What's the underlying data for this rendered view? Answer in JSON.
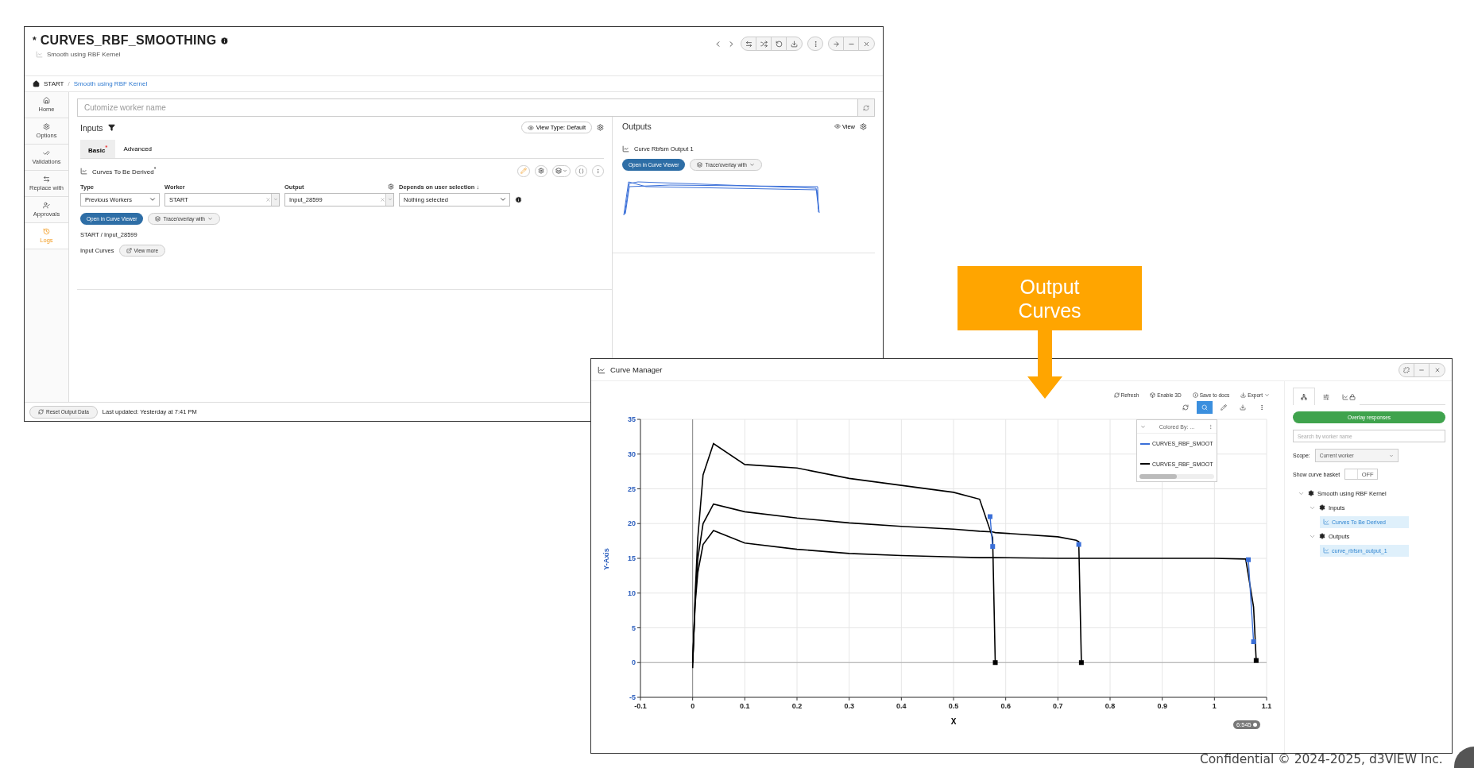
{
  "slide": {
    "callout": "Output Curves",
    "footer": "Confidential © 2024-2025, d3VIEW Inc."
  },
  "worker_window": {
    "modified_mark": "*",
    "title": "CURVES_RBF_SMOOTHING",
    "subtitle": "Smooth using RBF Kernel",
    "breadcrumb": [
      "START",
      "Smooth using RBF Kernel"
    ],
    "breadcrumb_separator": "/",
    "sidebar": [
      {
        "label": "Home",
        "selected": false
      },
      {
        "label": "Options",
        "selected": false
      },
      {
        "label": "Validations",
        "selected": false
      },
      {
        "label": "Replace with",
        "selected": false
      },
      {
        "label": "Approvals",
        "selected": false
      },
      {
        "label": "Logs",
        "selected": true
      }
    ],
    "name_field": {
      "placeholder": "Cutomize worker name"
    },
    "inputs": {
      "title": "Inputs",
      "view_type_button": "View Type: Default",
      "tabs": [
        {
          "label": "Basic",
          "selected": true,
          "mark": "*"
        },
        {
          "label": "Advanced",
          "selected": false
        }
      ],
      "section": {
        "title": "Curves To Be Derived",
        "mark": "*"
      },
      "fields": [
        {
          "label": "Type",
          "value": "Previous Workers",
          "kind": "select"
        },
        {
          "label": "Worker",
          "value": "START",
          "kind": "combo"
        },
        {
          "label": "Output",
          "value": "Input_28599",
          "kind": "combo"
        },
        {
          "label": "Depends on user selection ↓",
          "value": "Nothing selected",
          "kind": "select"
        }
      ],
      "buttons": [
        {
          "label": "Open in Curve Viewer",
          "kind": "primary"
        },
        {
          "label": "Trace/overlay with",
          "kind": "dropdown"
        }
      ],
      "path": "START / Input_28599",
      "curves_label": "Input Curves",
      "view_more_button": "View more"
    },
    "outputs": {
      "title": "Outputs",
      "view_button": "View",
      "curve_title": "Curve Rbfsm Output 1",
      "buttons": [
        {
          "label": "Open in Curve Viewer",
          "kind": "primary"
        },
        {
          "label": "Trace/overlay with",
          "kind": "dropdown"
        }
      ]
    },
    "footer": {
      "reset_button": "Reset Output Data",
      "last_updated": "Last updated: Yesterday at 7:41 PM"
    }
  },
  "curve_manager": {
    "title": "Curve Manager",
    "toolbar": [
      {
        "label": "Refresh",
        "kind": "plain"
      },
      {
        "label": "Enable 3D",
        "kind": "plain"
      },
      {
        "label": "Save to docs",
        "kind": "plain"
      },
      {
        "label": "Export",
        "kind": "dropdown"
      }
    ],
    "tools": [
      {
        "selected": false
      },
      {
        "selected": true
      },
      {
        "selected": false
      },
      {
        "selected": false
      },
      {
        "selected": false
      }
    ],
    "legend": {
      "title": "Colored By: ...",
      "items": [
        {
          "label": "CURVES_RBF_SMOOT",
          "color": "#3a6fd8"
        },
        {
          "label": "CURVES_RBF_SMOOT",
          "color": "#000000"
        }
      ]
    },
    "point_count": "6:545",
    "chart_data": {
      "type": "line",
      "grid": true,
      "xlabel": "X",
      "ylabel": "Y-Axis",
      "xlim": [
        -0.1,
        1.1
      ],
      "ylim": [
        -5,
        35
      ],
      "xticks": [
        -0.1,
        0,
        0.1,
        0.2,
        0.3,
        0.4,
        0.5,
        0.6,
        0.7,
        0.8,
        0.9,
        1,
        1.1
      ],
      "yticks": [
        -5,
        0,
        5,
        10,
        15,
        20,
        25,
        30,
        35
      ],
      "x": [
        0,
        0.005,
        0.01,
        0.02,
        0.04,
        0.1,
        0.2,
        0.3,
        0.4,
        0.5,
        0.55,
        0.57,
        0.575,
        0.58,
        0.7,
        0.735,
        0.74,
        0.745,
        0.9,
        1.0,
        1.06,
        1.065,
        1.075,
        1.08
      ],
      "series": [
        {
          "color": "#000000",
          "values": [
            -0.8,
            10,
            18,
            27,
            31.5,
            28.5,
            28,
            26.5,
            25.5,
            24.5,
            23.5,
            null,
            18,
            0,
            null,
            null,
            null,
            null,
            null,
            null,
            null,
            null,
            null,
            null
          ]
        },
        {
          "color": "#000000",
          "values": [
            0,
            9,
            15,
            20,
            22.8,
            21.7,
            20.8,
            20.1,
            19.6,
            19.2,
            18.9,
            null,
            18.8,
            18.7,
            18.1,
            17.6,
            17.4,
            0,
            null,
            null,
            null,
            null,
            null,
            null
          ]
        },
        {
          "color": "#000000",
          "values": [
            0,
            8.5,
            13,
            17,
            19,
            17.2,
            16.3,
            15.7,
            15.4,
            15.2,
            15.1,
            null,
            15.1,
            15.1,
            15,
            15,
            15,
            15,
            15,
            15,
            14.9,
            null,
            8,
            0.3
          ]
        },
        {
          "color": "#000000",
          "marker": "square",
          "values": [
            null,
            null,
            null,
            null,
            null,
            null,
            null,
            null,
            null,
            null,
            null,
            null,
            null,
            0,
            null,
            null,
            null,
            null,
            null,
            null,
            null,
            null,
            null,
            null
          ]
        },
        {
          "color": "#000000",
          "marker": "square",
          "values": [
            null,
            null,
            null,
            null,
            null,
            null,
            null,
            null,
            null,
            null,
            null,
            null,
            null,
            null,
            null,
            null,
            null,
            0,
            null,
            null,
            null,
            null,
            null,
            null
          ]
        },
        {
          "color": "#000000",
          "marker": "square",
          "values": [
            null,
            null,
            null,
            null,
            null,
            null,
            null,
            null,
            null,
            null,
            null,
            null,
            null,
            null,
            null,
            null,
            null,
            null,
            null,
            null,
            null,
            null,
            null,
            0.3
          ]
        },
        {
          "color": "#3a6fd8",
          "marker": "square",
          "values": [
            null,
            null,
            null,
            null,
            null,
            null,
            null,
            null,
            null,
            null,
            null,
            21,
            16.7,
            null,
            null,
            null,
            null,
            null,
            null,
            null,
            null,
            null,
            null,
            null
          ]
        },
        {
          "color": "#3a6fd8",
          "marker": "square",
          "values": [
            null,
            null,
            null,
            null,
            null,
            null,
            null,
            null,
            null,
            null,
            null,
            null,
            null,
            null,
            null,
            null,
            17.0,
            null,
            null,
            null,
            null,
            null,
            null,
            null
          ]
        },
        {
          "color": "#3a6fd8",
          "marker": "square",
          "values": [
            null,
            null,
            null,
            null,
            null,
            null,
            null,
            null,
            null,
            null,
            null,
            null,
            null,
            null,
            null,
            null,
            null,
            null,
            null,
            null,
            null,
            14.8,
            3,
            null
          ]
        }
      ]
    },
    "panel": {
      "tabs": [
        {
          "selected": true
        },
        {
          "selected": false
        },
        {
          "selected": false
        }
      ],
      "overlay_button": "Overlay responses",
      "search": {
        "placeholder": "Search by worker name"
      },
      "scope": {
        "label": "Scope:",
        "value": "Current worker"
      },
      "basket": {
        "label": "Show curve basket",
        "on": false,
        "state_text": "OFF"
      },
      "tree": [
        {
          "label": "Smooth using RBF Kernel",
          "kind": "group",
          "expanded": true,
          "children": [
            {
              "label": "Inputs",
              "kind": "group",
              "expanded": true,
              "children": [
                {
                  "label": "Curves To Be Derived",
                  "kind": "curve"
                }
              ]
            },
            {
              "label": "Outputs",
              "kind": "group",
              "expanded": true,
              "children": [
                {
                  "label": "curve_rbfsm_output_1",
                  "kind": "curve"
                }
              ]
            }
          ]
        }
      ]
    }
  }
}
